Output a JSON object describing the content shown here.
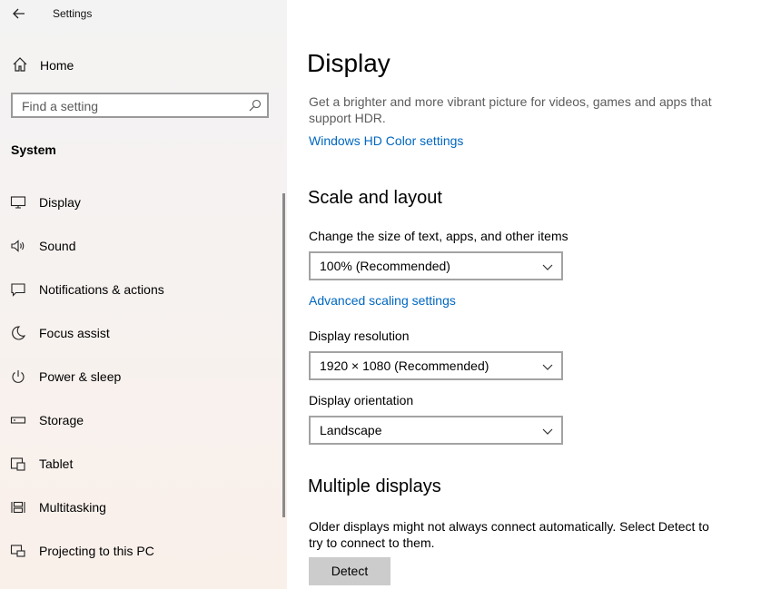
{
  "app": {
    "title": "Settings"
  },
  "sidebar": {
    "home_label": "Home",
    "search_placeholder": "Find a setting",
    "section_title": "System",
    "items": [
      {
        "label": "Display",
        "icon": "monitor-icon"
      },
      {
        "label": "Sound",
        "icon": "speaker-icon"
      },
      {
        "label": "Notifications & actions",
        "icon": "notification-icon"
      },
      {
        "label": "Focus assist",
        "icon": "moon-icon"
      },
      {
        "label": "Power & sleep",
        "icon": "power-icon"
      },
      {
        "label": "Storage",
        "icon": "storage-icon"
      },
      {
        "label": "Tablet",
        "icon": "tablet-icon"
      },
      {
        "label": "Multitasking",
        "icon": "multitasking-icon"
      },
      {
        "label": "Projecting to this PC",
        "icon": "projecting-icon"
      }
    ]
  },
  "main": {
    "title": "Display",
    "hdr_description": "Get a brighter and more vibrant picture for videos, games and apps that support HDR.",
    "hdr_link": "Windows HD Color settings",
    "scale_section_title": "Scale and layout",
    "scale_label": "Change the size of text, apps, and other items",
    "scale_value": "100% (Recommended)",
    "advanced_scaling_link": "Advanced scaling settings",
    "resolution_label": "Display resolution",
    "resolution_value": "1920 × 1080 (Recommended)",
    "orientation_label": "Display orientation",
    "orientation_value": "Landscape",
    "multiple_section_title": "Multiple displays",
    "multiple_description": "Older displays might not always connect automatically. Select Detect to try to connect to them.",
    "detect_button": "Detect"
  },
  "colors": {
    "accent_link": "#0067c0",
    "button_bg": "#cccccc"
  }
}
